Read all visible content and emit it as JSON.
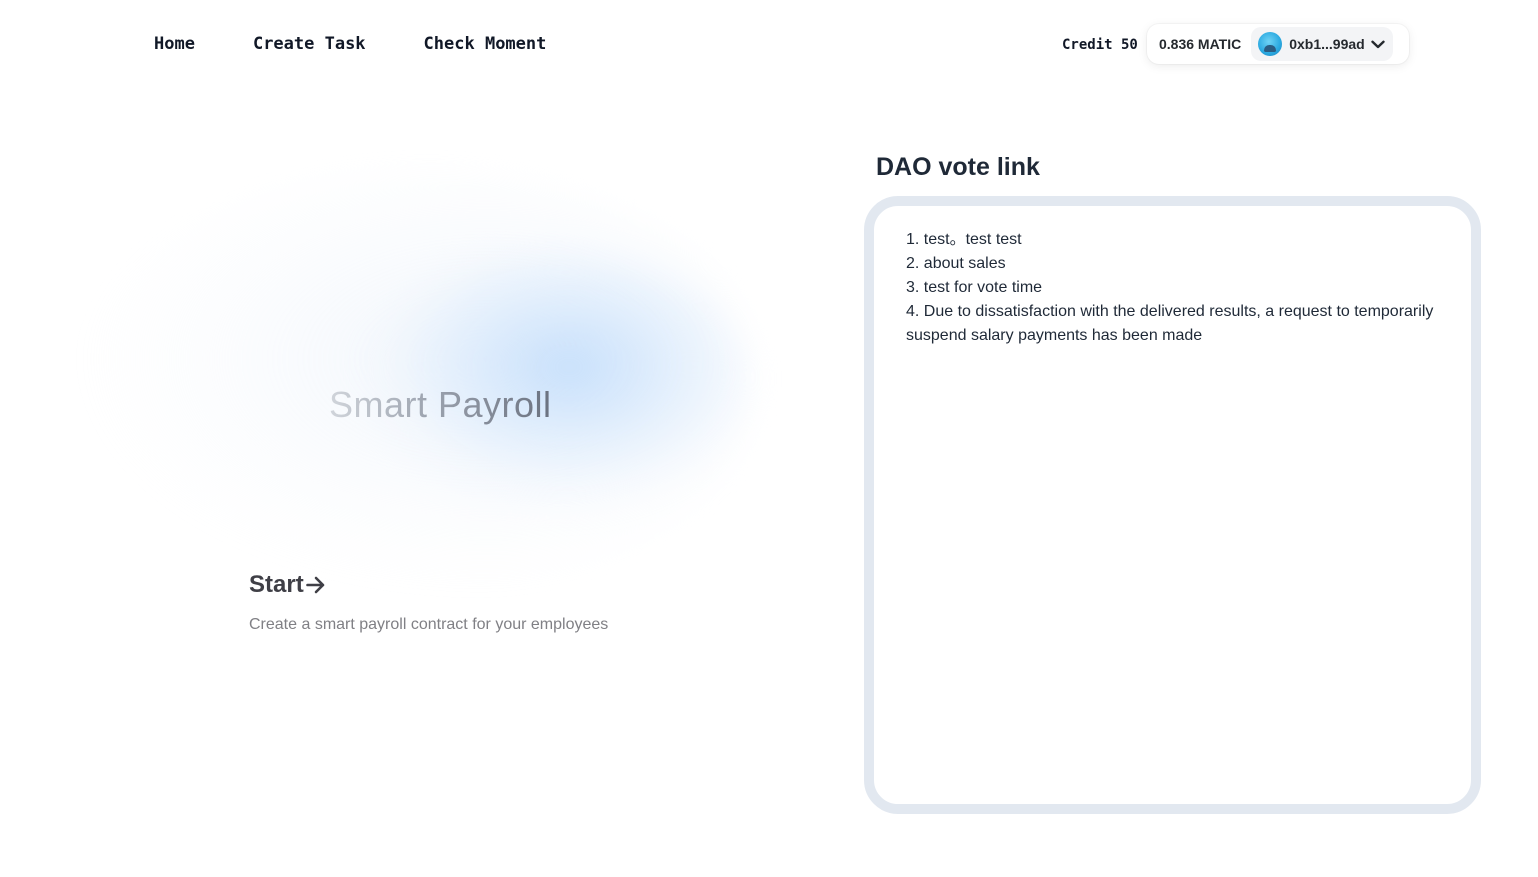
{
  "nav": {
    "links": [
      "Home",
      "Create Task",
      "Check Moment"
    ]
  },
  "account": {
    "credit": "Credit 50",
    "balance": "0.836 MATIC",
    "address": "0xb1...99ad"
  },
  "hero": {
    "title": "Smart Payroll",
    "start_label": "Start",
    "subtitle": "Create a smart payroll contract for your employees"
  },
  "dao": {
    "title": "DAO vote link",
    "items": [
      "1. test。test test",
      "2. about sales",
      "3. test for vote time",
      "4. Due to dissatisfaction with the delivered results, a request to temporarily suspend salary payments has been made"
    ]
  },
  "icons": {
    "avatar": "avatar-icon",
    "dropdown": "chevron-down-icon",
    "start_arrow": "arrow-right-icon"
  }
}
